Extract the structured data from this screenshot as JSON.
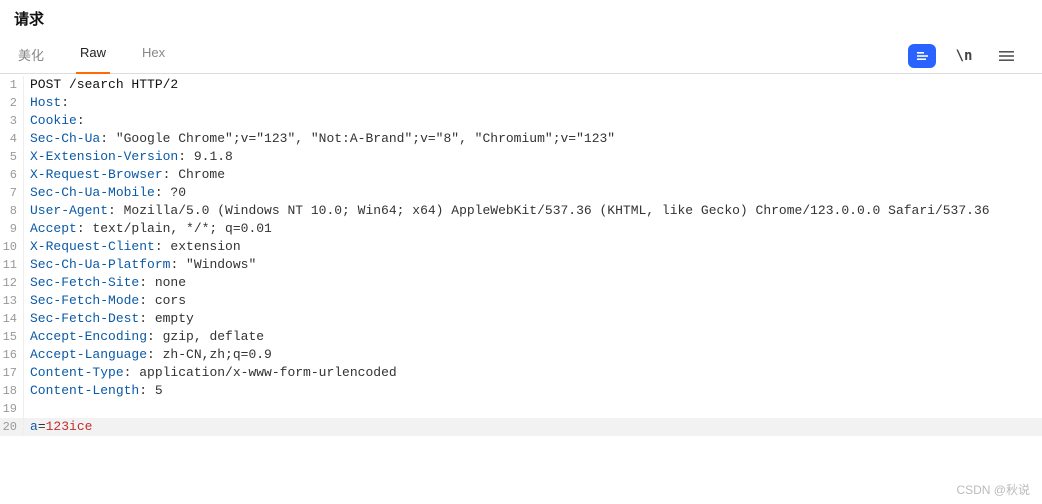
{
  "title": "请求",
  "tabs": [
    {
      "label": "美化",
      "active": false
    },
    {
      "label": "Raw",
      "active": true
    },
    {
      "label": "Hex",
      "active": false
    }
  ],
  "actions": {
    "wrap_toggle": "\\n"
  },
  "lines": [
    {
      "n": 1,
      "segs": [
        {
          "t": "POST /search HTTP/2",
          "c": "tk-method"
        }
      ]
    },
    {
      "n": 2,
      "segs": [
        {
          "t": "Host",
          "c": "tk-key"
        },
        {
          "t": ": ",
          "c": "tk-val"
        }
      ]
    },
    {
      "n": 3,
      "segs": [
        {
          "t": "Cookie",
          "c": "tk-key"
        },
        {
          "t": ": ",
          "c": "tk-val"
        }
      ]
    },
    {
      "n": 4,
      "segs": [
        {
          "t": "Sec-Ch-Ua",
          "c": "tk-key"
        },
        {
          "t": ": \"Google Chrome\";v=\"123\", \"Not:A-Brand\";v=\"8\", \"Chromium\";v=\"123\"",
          "c": "tk-val"
        }
      ]
    },
    {
      "n": 5,
      "segs": [
        {
          "t": "X-Extension-Version",
          "c": "tk-key"
        },
        {
          "t": ": 9.1.8",
          "c": "tk-val"
        }
      ]
    },
    {
      "n": 6,
      "segs": [
        {
          "t": "X-Request-Browser",
          "c": "tk-key"
        },
        {
          "t": ": Chrome",
          "c": "tk-val"
        }
      ]
    },
    {
      "n": 7,
      "segs": [
        {
          "t": "Sec-Ch-Ua-Mobile",
          "c": "tk-key"
        },
        {
          "t": ": ?0",
          "c": "tk-val"
        }
      ]
    },
    {
      "n": 8,
      "segs": [
        {
          "t": "User-Agent",
          "c": "tk-key"
        },
        {
          "t": ": Mozilla/5.0 (Windows NT 10.0; Win64; x64) AppleWebKit/537.36 (KHTML, like Gecko) Chrome/123.0.0.0 Safari/537.36",
          "c": "tk-val"
        }
      ]
    },
    {
      "n": 9,
      "segs": [
        {
          "t": "Accept",
          "c": "tk-key"
        },
        {
          "t": ": text/plain, */*; q=0.01",
          "c": "tk-val"
        }
      ]
    },
    {
      "n": 10,
      "segs": [
        {
          "t": "X-Request-Client",
          "c": "tk-key"
        },
        {
          "t": ": extension",
          "c": "tk-val"
        }
      ]
    },
    {
      "n": 11,
      "segs": [
        {
          "t": "Sec-Ch-Ua-Platform",
          "c": "tk-key"
        },
        {
          "t": ": \"Windows\"",
          "c": "tk-val"
        }
      ]
    },
    {
      "n": 12,
      "segs": [
        {
          "t": "Sec-Fetch-Site",
          "c": "tk-key"
        },
        {
          "t": ": none",
          "c": "tk-val"
        }
      ]
    },
    {
      "n": 13,
      "segs": [
        {
          "t": "Sec-Fetch-Mode",
          "c": "tk-key"
        },
        {
          "t": ": cors",
          "c": "tk-val"
        }
      ]
    },
    {
      "n": 14,
      "segs": [
        {
          "t": "Sec-Fetch-Dest",
          "c": "tk-key"
        },
        {
          "t": ": empty",
          "c": "tk-val"
        }
      ]
    },
    {
      "n": 15,
      "segs": [
        {
          "t": "Accept-Encoding",
          "c": "tk-key"
        },
        {
          "t": ": gzip, deflate",
          "c": "tk-val"
        }
      ]
    },
    {
      "n": 16,
      "segs": [
        {
          "t": "Accept-Language",
          "c": "tk-key"
        },
        {
          "t": ": zh-CN,zh;q=0.9",
          "c": "tk-val"
        }
      ]
    },
    {
      "n": 17,
      "segs": [
        {
          "t": "Content-Type",
          "c": "tk-key"
        },
        {
          "t": ": application/x-www-form-urlencoded",
          "c": "tk-val"
        }
      ]
    },
    {
      "n": 18,
      "segs": [
        {
          "t": "Content-Length",
          "c": "tk-key"
        },
        {
          "t": ": 5",
          "c": "tk-val"
        }
      ]
    },
    {
      "n": 19,
      "segs": [
        {
          "t": "",
          "c": "tk-val"
        }
      ]
    },
    {
      "n": 20,
      "hl": true,
      "segs": [
        {
          "t": "a",
          "c": "tk-param"
        },
        {
          "t": "=",
          "c": "tk-val"
        },
        {
          "t": "123ice",
          "c": "tk-str"
        }
      ]
    }
  ],
  "watermark": "CSDN @秋说"
}
